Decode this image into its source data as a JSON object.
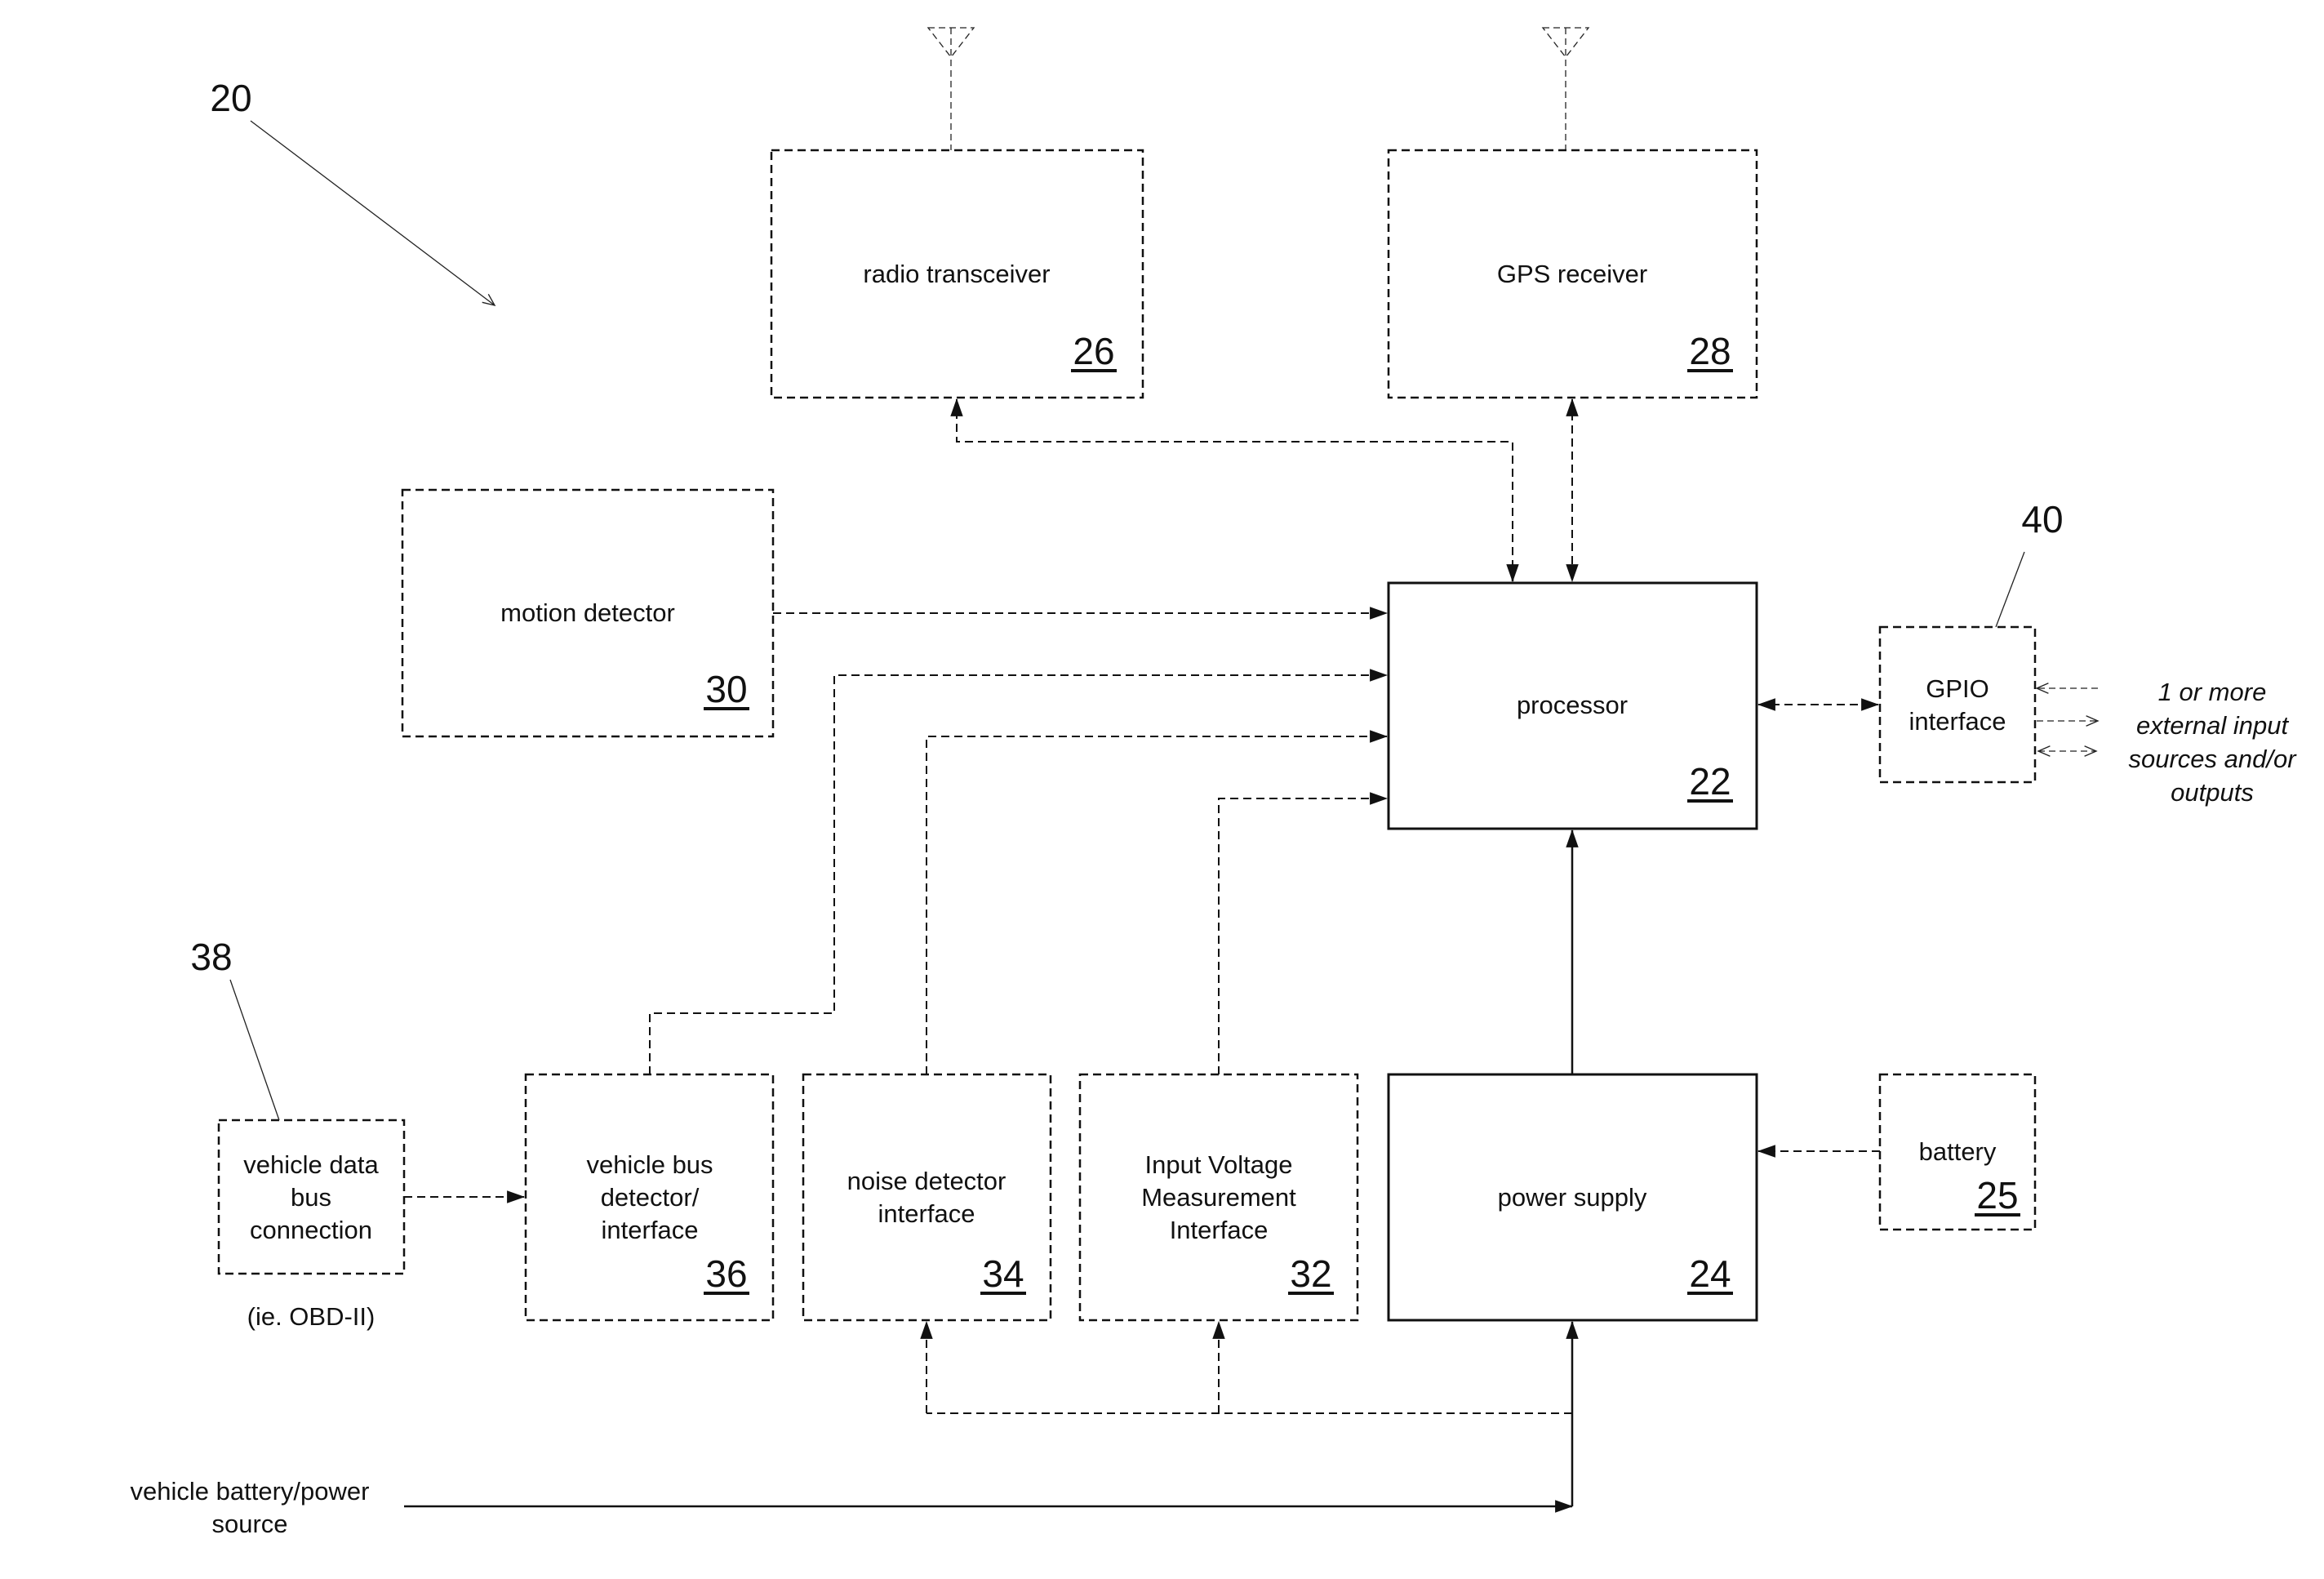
{
  "figure": {
    "reference_label": "20"
  },
  "blocks": {
    "radio_transceiver": {
      "label": [
        "radio transceiver"
      ],
      "ref": "26"
    },
    "gps_receiver": {
      "label": [
        "GPS receiver"
      ],
      "ref": "28"
    },
    "motion_detector": {
      "label": [
        "motion detector"
      ],
      "ref": "30"
    },
    "processor": {
      "label": [
        "processor"
      ],
      "ref": "22"
    },
    "gpio_interface": {
      "label": [
        "GPIO",
        "interface"
      ],
      "ref": "40"
    },
    "vehicle_data_bus_connection": {
      "label": [
        "vehicle data",
        "bus",
        "connection"
      ],
      "ref": "38",
      "note": "(ie. OBD-II)"
    },
    "vehicle_bus_detector": {
      "label": [
        "vehicle bus",
        "detector/",
        "interface"
      ],
      "ref": "36"
    },
    "noise_detector": {
      "label": [
        "noise detector",
        "interface"
      ],
      "ref": "34"
    },
    "input_voltage": {
      "label": [
        "Input Voltage",
        "Measurement",
        "Interface"
      ],
      "ref": "32"
    },
    "power_supply": {
      "label": [
        "power supply"
      ],
      "ref": "24"
    },
    "battery": {
      "label": [
        "battery"
      ],
      "ref": "25"
    }
  },
  "external": {
    "gpio_io_note": [
      "1 or more",
      "external input",
      "sources and/or",
      "outputs"
    ],
    "vehicle_power": [
      "vehicle battery/power",
      "source"
    ]
  }
}
